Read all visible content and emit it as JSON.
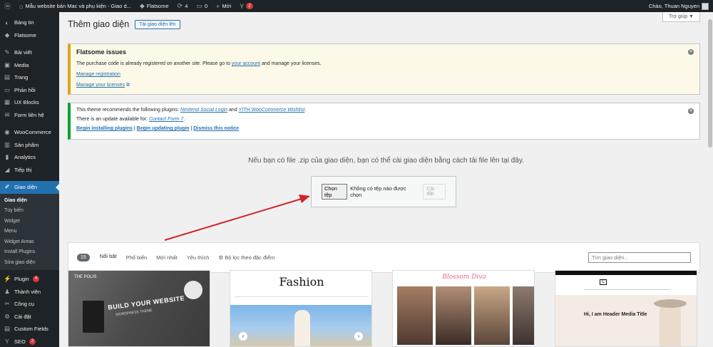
{
  "adminbar": {
    "site_title": "Mẫu website bán Mac và phụ kiện - Giao d...",
    "theme_name": "Flatsome",
    "updates_count": "4",
    "comments_count": "0",
    "new_label": "Mới",
    "yoast_badge": "2",
    "greeting": "Chào, Thuan Nguyen"
  },
  "sidebar": {
    "items": [
      {
        "label": "Bảng tin",
        "icon": "dashboard-icon"
      },
      {
        "label": "Flatsome",
        "icon": "flatsome-icon"
      },
      {
        "label": "Bài viết",
        "icon": "pin-icon"
      },
      {
        "label": "Media",
        "icon": "media-icon"
      },
      {
        "label": "Trang",
        "icon": "page-icon"
      },
      {
        "label": "Phản hồi",
        "icon": "comment-icon"
      },
      {
        "label": "UX Blocks",
        "icon": "blocks-icon"
      },
      {
        "label": "Form liên hệ",
        "icon": "mail-icon"
      },
      {
        "label": "WooCommerce",
        "icon": "woocommerce-icon"
      },
      {
        "label": "Sản phẩm",
        "icon": "product-icon"
      },
      {
        "label": "Analytics",
        "icon": "analytics-icon"
      },
      {
        "label": "Tiếp thị",
        "icon": "marketing-icon"
      },
      {
        "label": "Giao diện",
        "icon": "appearance-icon"
      },
      {
        "label": "Plugin",
        "icon": "plugin-icon",
        "badge": "4"
      },
      {
        "label": "Thành viên",
        "icon": "users-icon"
      },
      {
        "label": "Công cụ",
        "icon": "tools-icon"
      },
      {
        "label": "Cài đặt",
        "icon": "settings-icon"
      },
      {
        "label": "Custom Fields",
        "icon": "fields-icon"
      },
      {
        "label": "SEO",
        "icon": "seo-icon",
        "badge": "2"
      }
    ],
    "submenu": [
      "Giao diện",
      "Tùy biến",
      "Widget",
      "Menu",
      "Widget Areas",
      "Install Plugins",
      "Sửa giao diện"
    ]
  },
  "help_tab": "Trợ giúp ▼",
  "page": {
    "title": "Thêm giao diện",
    "upload_button": "Tải giao diện lên"
  },
  "notice_flatsome": {
    "title": "Flatsome issues",
    "text_before": "The purchase code is already registered on another site. Please go to",
    "link_account": "your account",
    "text_after": "and manage your licenses.",
    "link_registration": "Manage registration",
    "link_licenses": "Manage your licenses"
  },
  "notice_plugins": {
    "line1_before": "This theme recommends the following plugins:",
    "plugin1": "Nextend Social Login",
    "and": "and",
    "plugin2": "YITH WooCommerce Wishlist",
    "line2_before": "There is an update available for:",
    "plugin3": "Contact Form 7",
    "link_install": "Begin installing plugins",
    "link_update": "Begin updating plugin",
    "link_dismiss": "Dismiss this notice"
  },
  "upload": {
    "instruction": "Nếu bạn có file .zip của giao diện, bạn có thể cài giao diện bằng cách tải file lên tại đây.",
    "choose_file": "Chọn tệp",
    "no_file": "Không có tệp nào được chọn",
    "install": "Cài đặt"
  },
  "filter": {
    "count": "15",
    "tabs": [
      "Nổi bật",
      "Phổ biến",
      "Mới nhất",
      "Yêu thích"
    ],
    "feature_filter": "Bộ lọc theo đặc điểm",
    "search_placeholder": "Tìm giao diện..."
  },
  "themes": [
    {
      "logo": "THE POLIS",
      "headline": "BUILD YOUR WEBSITE",
      "sub": "WORDPRESS THEME"
    },
    {
      "title": "Fashion"
    },
    {
      "title": "Blossom Diva"
    },
    {
      "headline": "Hi, I am Header Media Title"
    }
  ],
  "colors": {
    "admin_dark": "#1d2327",
    "accent": "#2271b1",
    "warning": "#dba617",
    "success": "#00a32a",
    "badge": "#d63638",
    "arrow": "#d2232a"
  }
}
